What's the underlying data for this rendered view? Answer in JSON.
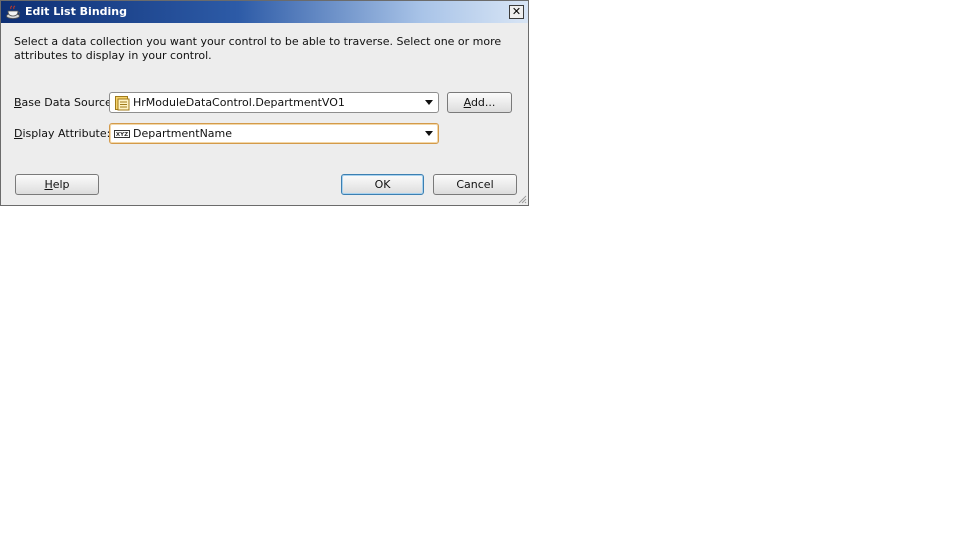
{
  "window": {
    "title": "Edit List Binding",
    "close_symbol": "✕",
    "icon": "oracle-jdeveloper-cup-icon"
  },
  "instructions": "Select a data collection you want your control to be able to traverse. Select one or more attributes to display in your control.",
  "base_data_source": {
    "label": "Base Data Source:",
    "mnemonic": "B",
    "label_rest": "ase Data Source:",
    "value": "HrModuleDataControl.DepartmentVO1",
    "icon": "view-object-icon"
  },
  "add_button": {
    "label": "Add...",
    "mnemonic": "A",
    "label_rest": "dd..."
  },
  "display_attribute": {
    "label": "Display Attribute:",
    "mnemonic": "D",
    "label_rest": "isplay Attribute:",
    "value": "DepartmentName",
    "icon": "attribute-icon"
  },
  "buttons": {
    "help_mnemonic": "H",
    "help_rest": "elp",
    "ok": "OK",
    "cancel": "Cancel"
  },
  "colors": {
    "titlebar_start": "#0e2f74",
    "titlebar_end": "#d8e5f5",
    "dialog_bg": "#ededed",
    "focus_border": "#d39a4a",
    "default_button_border": "#3c7fb1"
  }
}
